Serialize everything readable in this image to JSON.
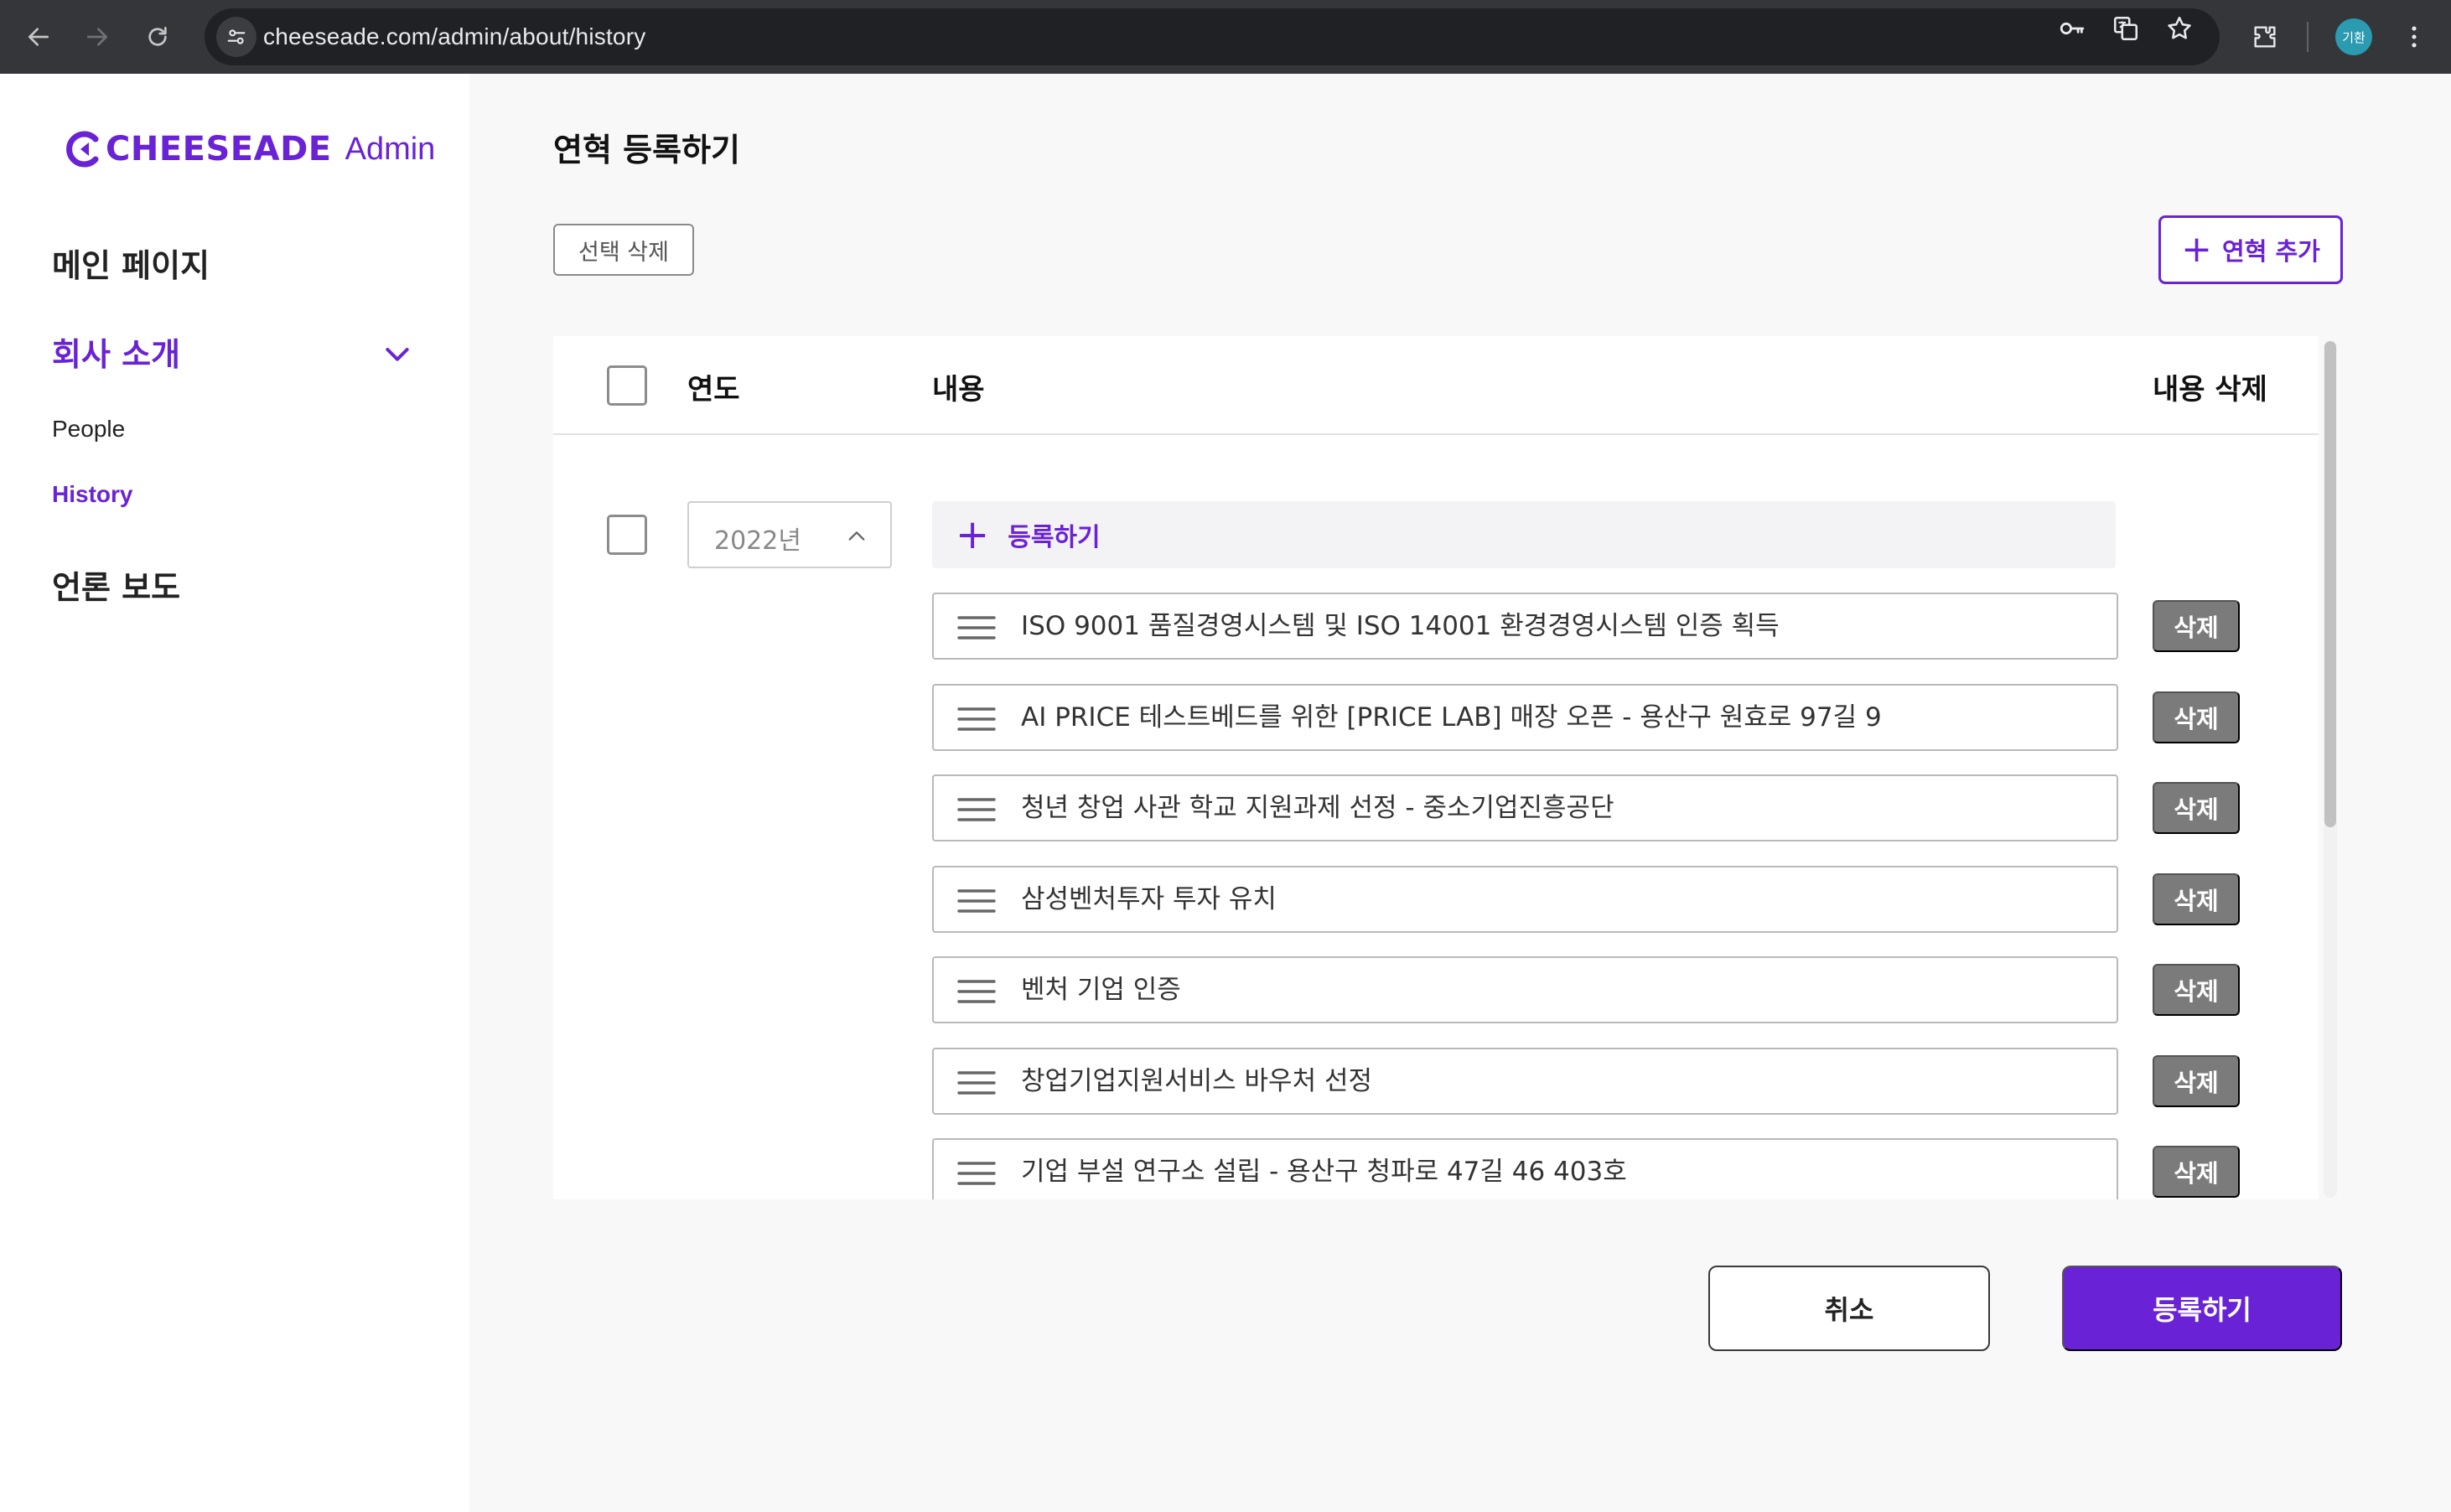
{
  "browser": {
    "url": "cheeseade.com/admin/about/history",
    "profile_initials": "기환"
  },
  "brand": {
    "logo_text": "CHEESEADE",
    "admin_label": "Admin",
    "accent_color": "#6a22d6"
  },
  "sidebar": {
    "items": [
      {
        "label": "메인 페이지",
        "active": false
      },
      {
        "label": "회사 소개",
        "active": true,
        "expanded": true
      },
      {
        "label": "언론 보도",
        "active": false
      }
    ],
    "sub_items": [
      {
        "label": "People",
        "active": false
      },
      {
        "label": "History",
        "active": true
      }
    ]
  },
  "page": {
    "title": "연혁 등록하기",
    "select_delete_label": "선택 삭제",
    "add_history_label": "연혁 추가"
  },
  "table": {
    "columns": {
      "year": "연도",
      "content": "내용",
      "delete": "내용 삭제"
    },
    "groups": [
      {
        "year": "2022년",
        "register_label": "등록하기",
        "delete_label": "삭제",
        "entries": [
          "ISO 9001 품질경영시스템 및 ISO 14001 환경경영시스템 인증 획득",
          "AI PRICE 테스트베드를 위한 [PRICE LAB] 매장 오픈 - 용산구 원효로 97길 9",
          "청년 창업 사관 학교 지원과제 선정 - 중소기업진흥공단",
          "삼성벤처투자 투자 유치",
          "벤처 기업 인증",
          "창업기업지원서비스 바우처 선정",
          "기업 부설 연구소 설립 - 용산구 청파로 47길 46 403호"
        ]
      }
    ]
  },
  "footer": {
    "cancel_label": "취소",
    "submit_label": "등록하기"
  }
}
